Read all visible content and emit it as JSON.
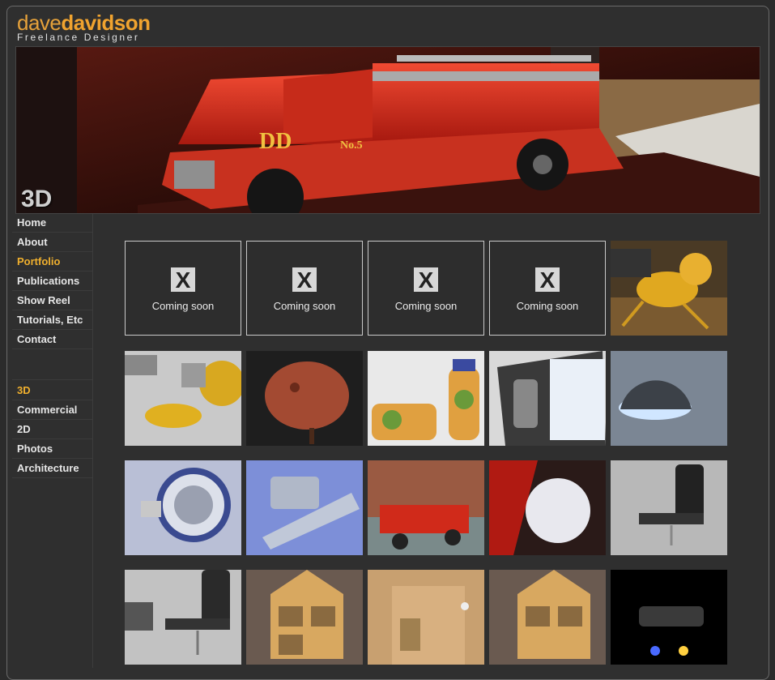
{
  "logo": {
    "first": "dave",
    "last": "davidson",
    "tagline": "Freelance Designer"
  },
  "banner": {
    "label": "3D"
  },
  "nav_main": [
    {
      "label": "Home",
      "active": false
    },
    {
      "label": "About",
      "active": false
    },
    {
      "label": "Portfolio",
      "active": true
    },
    {
      "label": "Publications",
      "active": false
    },
    {
      "label": "Show Reel",
      "active": false
    },
    {
      "label": "Tutorials, Etc",
      "active": false
    },
    {
      "label": "Contact",
      "active": false
    }
  ],
  "nav_sub": [
    {
      "label": "3D",
      "active": true
    },
    {
      "label": "Commercial",
      "active": false
    },
    {
      "label": "2D",
      "active": false
    },
    {
      "label": "Photos",
      "active": false
    },
    {
      "label": "Architecture",
      "active": false
    }
  ],
  "placeholder": {
    "mark": "X",
    "caption": "Coming soon"
  },
  "colors": {
    "accent": "#f0b02e",
    "bg": "#2b2b2b"
  }
}
